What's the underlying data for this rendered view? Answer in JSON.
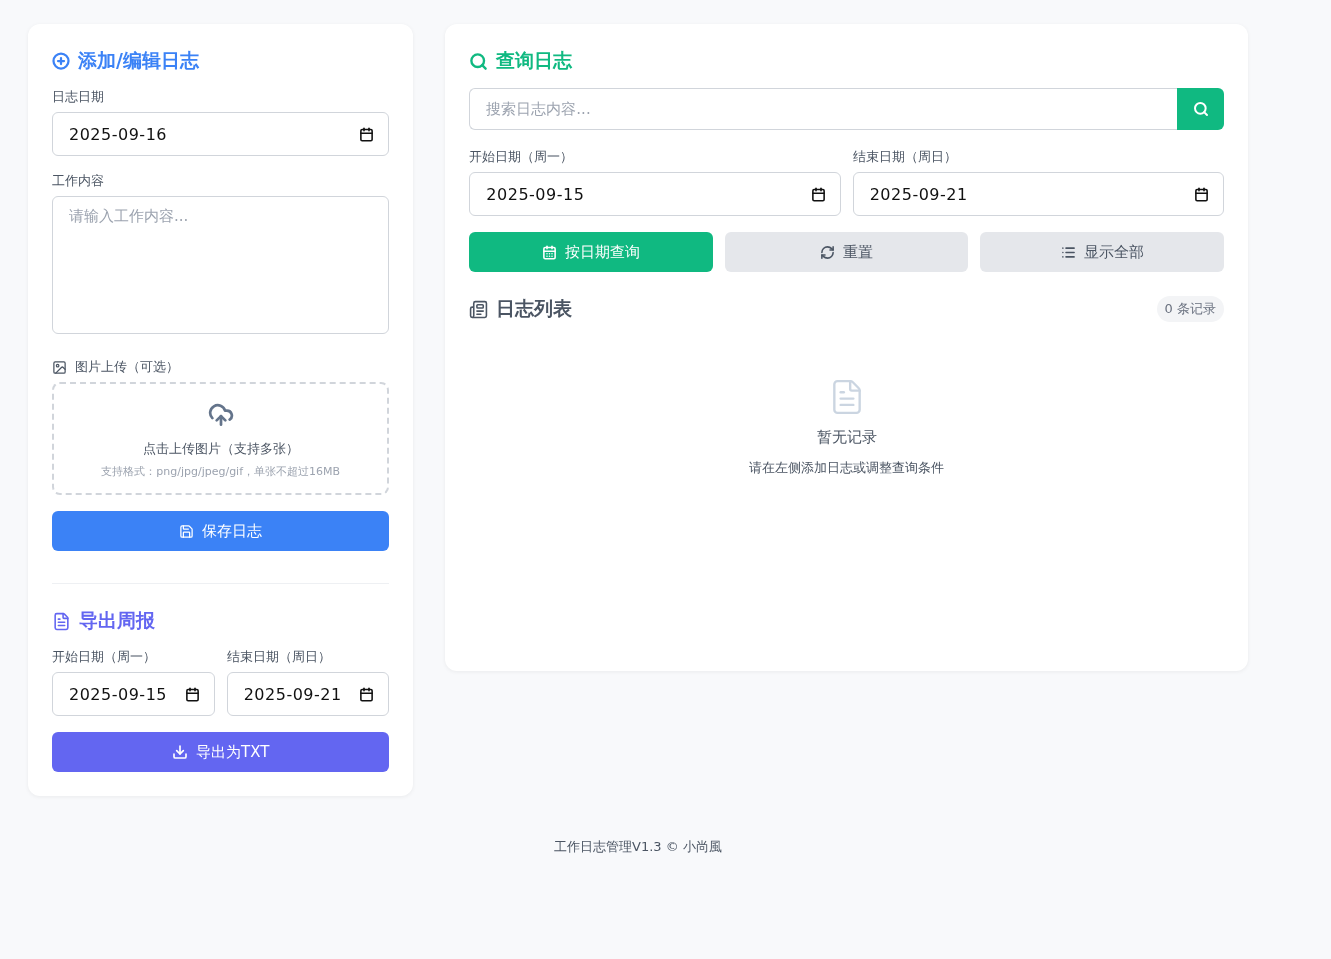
{
  "editor": {
    "title": "添加/编辑日志",
    "date_label": "日志日期",
    "date_value": "2025-09-16",
    "content_label": "工作内容",
    "content_placeholder": "请输入工作内容...",
    "upload_label": "图片上传（可选）",
    "upload_text": "点击上传图片（支持多张）",
    "upload_hint": "支持格式：png/jpg/jpeg/gif，单张不超过16MB",
    "save_button": "保存日志"
  },
  "export": {
    "title": "导出周报",
    "start_label": "开始日期（周一）",
    "start_value": "2025-09-15",
    "end_label": "结束日期（周日）",
    "end_value": "2025-09-21",
    "button": "导出为TXT"
  },
  "query": {
    "title": "查询日志",
    "search": {
      "placeholder": "搜索日志内容..."
    },
    "start_label": "开始日期（周一）",
    "start_value": "2025-09-15",
    "end_label": "结束日期（周日）",
    "end_value": "2025-09-21",
    "buttons": [
      {
        "label": "按日期查询",
        "kind": "primary"
      },
      {
        "label": "重置",
        "kind": "secondary"
      },
      {
        "label": "显示全部",
        "kind": "secondary"
      }
    ]
  },
  "list": {
    "title": "日志列表",
    "count": "0 条记录",
    "empty_title": "暂无记录",
    "empty_hint": "请在左侧添加日志或调整查询条件"
  },
  "footer": "工作日志管理V1.3 © 小尚風"
}
